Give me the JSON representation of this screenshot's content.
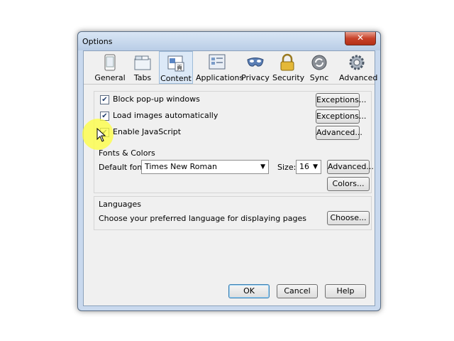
{
  "window": {
    "title": "Options",
    "close_label": "✕"
  },
  "toolbar": {
    "tabs": [
      {
        "label": "General",
        "icon": "general-icon"
      },
      {
        "label": "Tabs",
        "icon": "tabs-icon"
      },
      {
        "label": "Content",
        "icon": "content-icon",
        "selected": true
      },
      {
        "label": "Applications",
        "icon": "applications-icon"
      },
      {
        "label": "Privacy",
        "icon": "privacy-mask-icon"
      },
      {
        "label": "Security",
        "icon": "padlock-icon"
      },
      {
        "label": "Sync",
        "icon": "sync-icon"
      },
      {
        "label": "Advanced",
        "icon": "gear-icon"
      }
    ]
  },
  "content": {
    "block_popups": {
      "label": "Block pop-up windows",
      "checked": true,
      "button": "Exceptions..."
    },
    "load_images": {
      "label": "Load images automatically",
      "checked": true,
      "button": "Exceptions..."
    },
    "enable_js": {
      "label": "Enable JavaScript",
      "checked": true,
      "button": "Advanced..."
    },
    "fonts": {
      "heading": "Fonts & Colors",
      "default_font_label": "Default font:",
      "default_font_value": "Times New Roman",
      "size_label": "Size:",
      "size_value": "16",
      "advanced_button": "Advanced...",
      "colors_button": "Colors..."
    },
    "languages": {
      "heading": "Languages",
      "description": "Choose your preferred language for displaying pages",
      "choose_button": "Choose..."
    }
  },
  "footer": {
    "ok": "OK",
    "cancel": "Cancel",
    "help": "Help"
  },
  "colors": {
    "titlebar": "#c9d9ee",
    "selected_tab": "#dce9f7",
    "close": "#c7422a",
    "highlight": "#ffff3c"
  }
}
